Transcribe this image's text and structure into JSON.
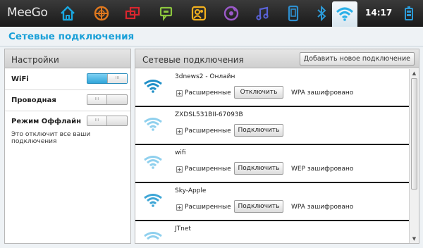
{
  "topbar": {
    "logo": "MeeGo",
    "clock": "14:17",
    "icons": [
      "home-icon",
      "browser-icon",
      "windows-icon",
      "chat-icon",
      "people-icon",
      "media-icon",
      "music-icon",
      "device-icon",
      "bluetooth-icon",
      "wifi-icon",
      "battery-icon"
    ],
    "active_icon": "wifi-icon"
  },
  "page": {
    "title": "Сетевые подключения"
  },
  "settings": {
    "header": "Настройки",
    "rows": [
      {
        "label": "WiFi",
        "state": "on",
        "toggle_text": "III"
      },
      {
        "label": "Проводная",
        "state": "off",
        "toggle_text": "III"
      },
      {
        "label": "Режим Оффлайн",
        "state": "off",
        "toggle_text": "III"
      }
    ],
    "note": "Это отключит все ваши подключения"
  },
  "connections": {
    "header": "Сетевые подключения",
    "add_button": "Добавить новое подключение",
    "advanced_label": "Расширенные",
    "items": [
      {
        "name": "3dnews2 - Онлайн",
        "button": "Отключить",
        "security": "WPA зашифровано",
        "connected": true
      },
      {
        "name": "ZXDSL531BII-67093B",
        "button": "Подключить",
        "security": "",
        "connected": false
      },
      {
        "name": "wifi",
        "button": "Подключить",
        "security": "WEP зашифровано",
        "connected": false
      },
      {
        "name": "Sky-Apple",
        "button": "Подключить",
        "security": "WPA зашифровано",
        "connected": false
      },
      {
        "name": "JTnet",
        "button": "",
        "security": "",
        "connected": false
      }
    ]
  },
  "colors": {
    "accent": "#1aa0d8",
    "wifi_connected": "#1f8fc7",
    "wifi_available": "#8fd0ee"
  }
}
